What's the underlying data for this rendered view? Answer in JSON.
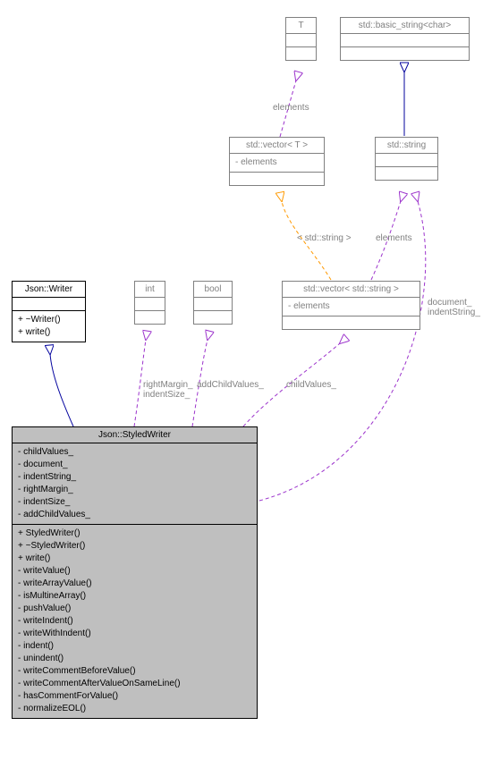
{
  "classes": {
    "T": {
      "title": "T"
    },
    "basic_string": {
      "title": "std::basic_string<char>"
    },
    "vectorT": {
      "title": "std::vector< T >",
      "attrs": [
        "- elements"
      ]
    },
    "std_string": {
      "title": "std::string"
    },
    "JsonWriter": {
      "title": "Json::Writer",
      "methods": [
        "+ ~Writer()",
        "+ write()"
      ]
    },
    "int_": {
      "title": "int"
    },
    "bool_": {
      "title": "bool"
    },
    "vectorStr": {
      "title": "std::vector< std::string >",
      "attrs": [
        "- elements"
      ]
    },
    "StyledWriter": {
      "title": "Json::StyledWriter",
      "attrs": [
        "- childValues_",
        "- document_",
        "- indentString_",
        "- rightMargin_",
        "- indentSize_",
        "- addChildValues_"
      ],
      "methods": [
        "+ StyledWriter()",
        "+ ~StyledWriter()",
        "+ write()",
        "- writeValue()",
        "- writeArrayValue()",
        "- isMultineArray()",
        "- pushValue()",
        "- writeIndent()",
        "- writeWithIndent()",
        "- indent()",
        "- unindent()",
        "- writeCommentBeforeValue()",
        "- writeCommentAfterValueOnSameLine()",
        "- hasCommentForValue()",
        "- normalizeEOL()"
      ]
    }
  },
  "labels": {
    "elements1": "elements",
    "templ_str": "< std::string >",
    "elements2": "elements",
    "rightMargin": "rightMargin_\nindentSize_",
    "addChildValues": "addChildValues_",
    "childValues": "childValues_",
    "document": "document_\nindentString_"
  }
}
